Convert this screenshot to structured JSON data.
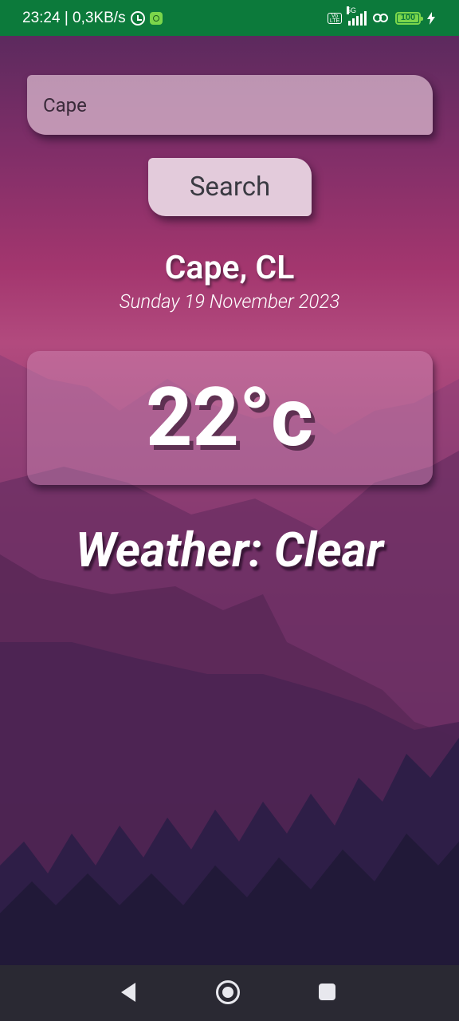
{
  "status_bar": {
    "time_speed": "23:24 | 0,3KB/s",
    "network": "5G",
    "volte": "Vo LTE",
    "battery": "100",
    "battery_level": 1.0
  },
  "search": {
    "value": "Cape",
    "button_label": "Search"
  },
  "location": {
    "city": "Cape, CL",
    "date": "Sunday 19 November 2023"
  },
  "weather": {
    "temperature": "22°c",
    "description": "Weather: Clear"
  },
  "colors": {
    "status_bar": "#0c7a3b",
    "nav_bar": "#2a2933",
    "battery": "#7bd64b"
  },
  "icons": [
    "alarm-icon",
    "app-icon",
    "volte-icon",
    "signal-icon",
    "link-icon",
    "battery-icon",
    "bolt-icon",
    "back-icon",
    "home-icon",
    "recent-apps-icon"
  ]
}
